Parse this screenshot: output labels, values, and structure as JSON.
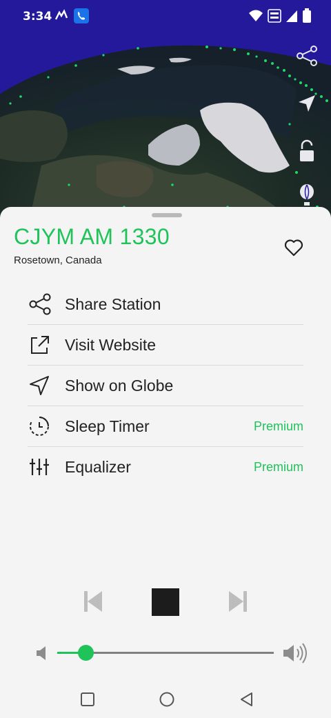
{
  "status": {
    "time": "3:34",
    "icons": [
      "app-logo-icon",
      "phone-call-icon",
      "wifi-icon",
      "volte-icon",
      "signal-icon",
      "battery-icon"
    ]
  },
  "globe": {
    "tools": [
      "share-icon",
      "navigation-arrow-icon",
      "unlock-icon",
      "balloon-icon"
    ]
  },
  "station": {
    "name": "CJYM AM 1330",
    "location": "Rosetown, Canada"
  },
  "menu": {
    "items": [
      {
        "label": "Share Station",
        "icon": "share-icon",
        "badge": ""
      },
      {
        "label": "Visit Website",
        "icon": "external-link-icon",
        "badge": ""
      },
      {
        "label": "Show on Globe",
        "icon": "navigation-arrow-icon",
        "badge": ""
      },
      {
        "label": "Sleep Timer",
        "icon": "timer-icon",
        "badge": "Premium"
      },
      {
        "label": "Equalizer",
        "icon": "equalizer-icon",
        "badge": "Premium"
      }
    ]
  },
  "player": {
    "volume_level": 0.13
  },
  "colors": {
    "accent": "#1fc35a",
    "globe_sky": "#23199a"
  }
}
